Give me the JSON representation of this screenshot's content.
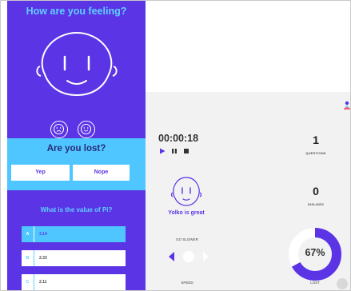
{
  "feeling": {
    "title": "How are you feeling?"
  },
  "lost": {
    "title": "Are you lost?",
    "yes_label": "Yep",
    "no_label": "Nope"
  },
  "question": {
    "text": "What is the value of Pi?",
    "answers": [
      {
        "letter": "A",
        "value": "3.14",
        "selected": true
      },
      {
        "letter": "B",
        "value": "2.33",
        "selected": false
      },
      {
        "letter": "C",
        "value": "2.11",
        "selected": false
      }
    ]
  },
  "session": {
    "timer": "00:00:18"
  },
  "stats": {
    "questions": {
      "value": "1",
      "label": "QUESTIONS"
    },
    "dislikes": {
      "value": "0",
      "label": "DISLIKES"
    }
  },
  "status": {
    "text": "Yolko is great"
  },
  "speed": {
    "hint": "GO SLOWER",
    "label": "SPEED"
  },
  "lost_meter": {
    "percent_label": "67%",
    "fraction": 0.67,
    "label": "LOST"
  },
  "colors": {
    "purple": "#5b34e6",
    "cyan": "#4fc6ff",
    "light_cyan": "#5fd0ff",
    "panel": "#f2f2f2"
  },
  "icons": [
    "sad-face-icon",
    "happy-face-icon",
    "user-icon",
    "play-icon",
    "pause-icon",
    "stop-icon",
    "arrow-left-icon",
    "arrow-right-icon",
    "settings-icon"
  ]
}
